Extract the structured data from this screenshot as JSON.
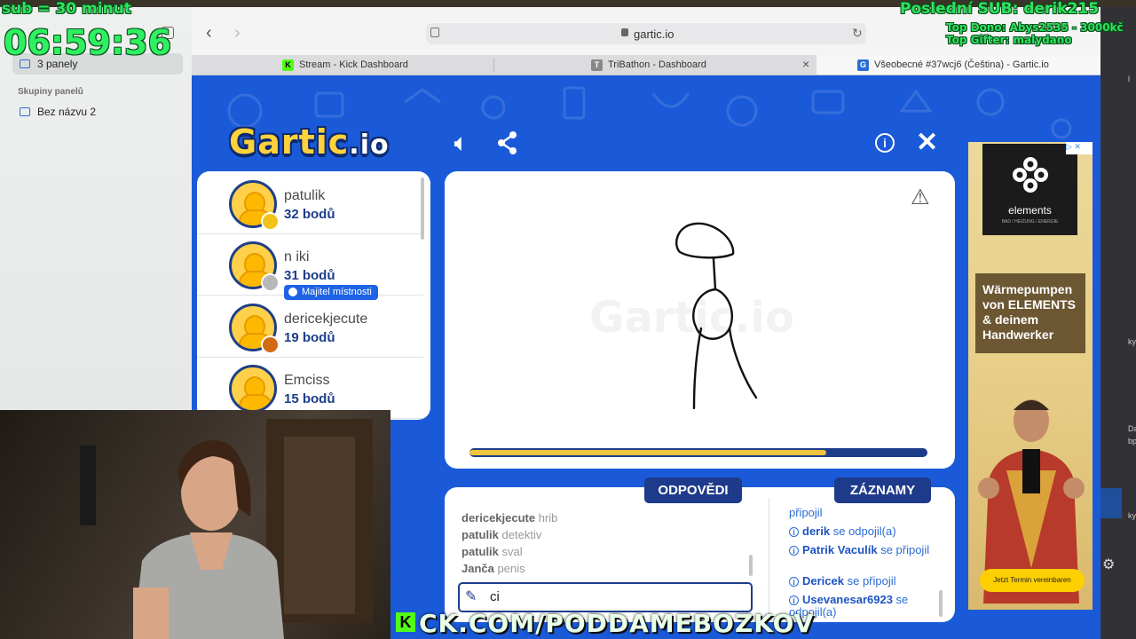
{
  "overlay": {
    "sub_rule": "sub = 30 minut",
    "timer": "06:59:36",
    "last_sub": "Poslední SUB: derik215",
    "top_dono": "Top Dono: Abys2535 - 3000kč",
    "top_gifter": "Top Gifter: malydano",
    "kick_url": "CK.COM/PODDAMEBOZKOV"
  },
  "browser": {
    "sidebar": {
      "panels_label": "3 panely",
      "groups_title": "Skupiny panelů",
      "unnamed_group": "Bez názvu 2"
    },
    "url": "gartic.io",
    "tabs": [
      {
        "label": "Stream - Kick Dashboard",
        "favicon": "K"
      },
      {
        "label": "TriBathon - Dashboard",
        "favicon": "T"
      },
      {
        "label": "Všeobecné #37wcj6 (Čeština) - Gartic.io",
        "favicon": "G"
      }
    ]
  },
  "game": {
    "logo_main": "Gartic",
    "logo_suffix": ".io",
    "watermark": "Gartic.io",
    "timer_progress": 0.78,
    "players": [
      {
        "name": "patulik",
        "points": "32 bodů",
        "dot_color": "#f2c21b"
      },
      {
        "name": "n iki",
        "points": "31 bodů",
        "dot_color": "#b8b8b8",
        "badge": "Majitel místnosti"
      },
      {
        "name": "dericekjecute",
        "points": "19 bodů",
        "dot_color": "#d26a12"
      },
      {
        "name": "Emciss",
        "points": "15 bodů",
        "dot_color": null
      }
    ],
    "answers_tab": "ODPOVĚDI",
    "log_tab": "ZÁZNAMY",
    "answers": [
      {
        "user": "dericekjecute",
        "text": "hrib"
      },
      {
        "user": "patulik",
        "text": "detektiv"
      },
      {
        "user": "patulik",
        "text": "sval"
      },
      {
        "user": "Janča",
        "text": "penis"
      }
    ],
    "answer_input_value": "ci",
    "log": [
      {
        "user": "",
        "text": "připojil"
      },
      {
        "user": "derik",
        "text": "se odpojil(a)"
      },
      {
        "user": "Patrik Vaculík",
        "text": "se připojil"
      },
      {
        "user": "Dericek",
        "text": "se připojil"
      },
      {
        "user": "Usevanesar6923",
        "text": "se odpojil(a)"
      }
    ]
  },
  "ad": {
    "brand": "elements",
    "brand_sub": "BAD / HEIZUNG / ENERGIE",
    "headline": "Wärmepumpen von ELEMENTS & deinem Handwerker",
    "cta": "Jetzt Termin vereinbaren"
  },
  "right_strip": [
    "l",
    "ky",
    "Da",
    "bp",
    "ky"
  ]
}
